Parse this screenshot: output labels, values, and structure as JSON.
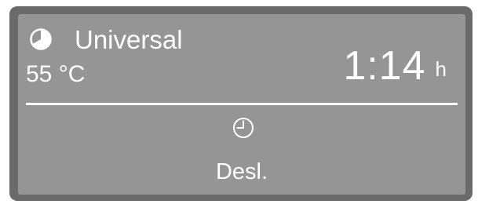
{
  "display": {
    "program_icon": "program-progress-icon",
    "program_name": "Universal",
    "temperature": "55 °C",
    "remaining_time": "1:14",
    "remaining_time_unit": "h",
    "delay_icon": "clock-icon",
    "delay_start_status": "Desl."
  }
}
